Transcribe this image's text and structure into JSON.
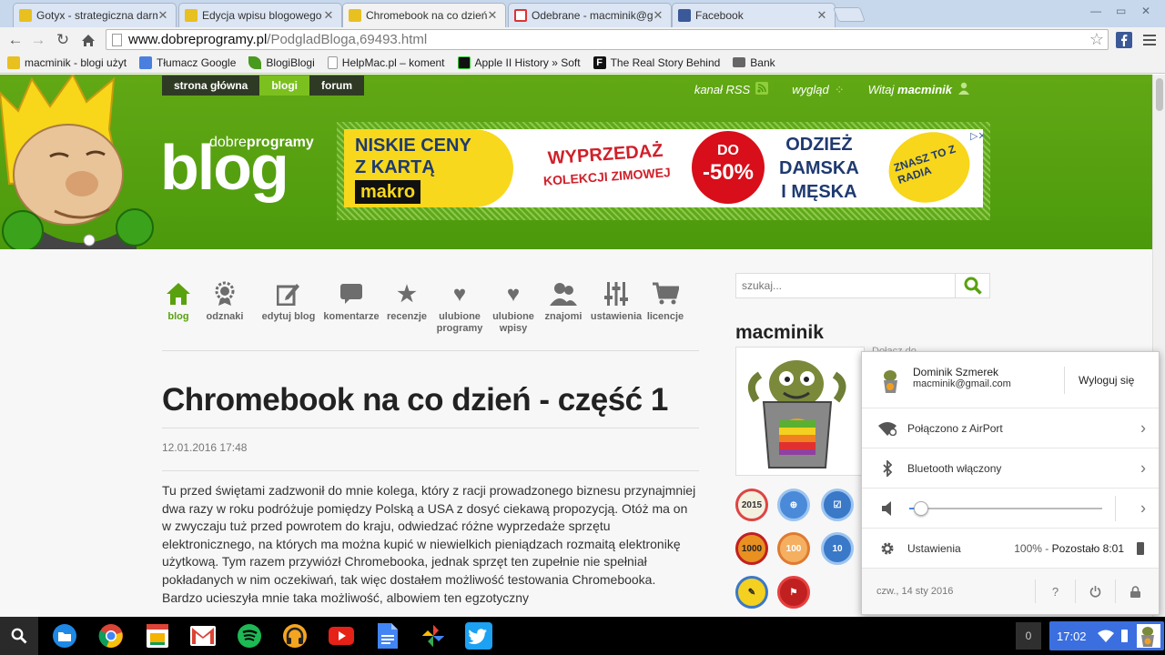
{
  "browser": {
    "tabs": [
      {
        "title": "Gotyx - strategiczna darm",
        "active": false
      },
      {
        "title": "Edycja wpisu blogowego",
        "active": false
      },
      {
        "title": "Chromebook na co dzień",
        "active": true
      },
      {
        "title": "Odebrane - macminik@gm",
        "active": false
      },
      {
        "title": "Facebook",
        "active": false
      }
    ],
    "url_host": "www.dobreprogramy.pl",
    "url_path": "/PodgladBloga,69493.html",
    "bookmarks": [
      {
        "label": "macminik - blogi użyt",
        "color": "#d33"
      },
      {
        "label": "Tłumacz Google",
        "color": "#4a7fe0"
      },
      {
        "label": "BlogiBlogi",
        "color": "#4a9a20"
      },
      {
        "label": "HelpMac.pl – koment",
        "color": "#999"
      },
      {
        "label": "Apple II History » Soft",
        "color": "#111"
      },
      {
        "label": "The Real Story Behind",
        "color": "#111"
      },
      {
        "label": "Bank",
        "color": "#666"
      }
    ]
  },
  "site": {
    "topnav": [
      "strona główna",
      "blogi",
      "forum"
    ],
    "rss": "kanał RSS",
    "look": "wygląd",
    "welcome": "Witaj",
    "welcome_user": "macminik",
    "logo_small_a": "dobre",
    "logo_small_b": "programy",
    "logo_big": "blog"
  },
  "ad": {
    "line1": "NISKIE CENY",
    "line2": "Z KARTĄ",
    "brand": "makro",
    "sale": "WYPRZEDAŻ",
    "sale_sub": "KOLEKCJI ZIMOWEJ",
    "discount_pre": "DO",
    "discount": "-50%",
    "clothes1": "ODZIEŻ",
    "clothes2": "DAMSKA",
    "clothes3": "I MĘSKA",
    "radio": "ZNASZ TO Z RADIA"
  },
  "blog_nav": [
    {
      "label": "blog",
      "icon": "home-icon",
      "selected": true
    },
    {
      "label": "odznaki",
      "icon": "medal-icon",
      "selected": false
    },
    {
      "label": "edytuj blog",
      "icon": "edit-icon",
      "selected": false
    },
    {
      "label": "komentarze",
      "icon": "comment-icon",
      "selected": false
    },
    {
      "label": "recenzje",
      "icon": "star-icon",
      "selected": false
    },
    {
      "label": "ulubione programy",
      "icon": "heart-icon",
      "selected": false
    },
    {
      "label": "ulubione wpisy",
      "icon": "heart-icon",
      "selected": false
    },
    {
      "label": "znajomi",
      "icon": "users-icon",
      "selected": false
    },
    {
      "label": "ustawienia",
      "icon": "sliders-icon",
      "selected": false
    },
    {
      "label": "licencje",
      "icon": "cart-icon",
      "selected": false
    }
  ],
  "post": {
    "title": "Chromebook na co dzień - część 1",
    "date": "12.01.2016 17:48",
    "body": "Tu przed świętami zadzwonił do mnie kolega, który z racji prowadzonego biznesu przynajmniej dwa razy w roku podróżuje pomiędzy Polską a USA z dosyć ciekawą propozycją. Otóż ma on w zwyczaju tuż przed powrotem do kraju, odwiedzać różne wyprzedaże sprzętu elektronicznego, na których ma można kupić w niewielkich pieniądzach rozmaitą elektronikę użytkową. Tym razem przywiózł Chromebooka, jednak sprzęt ten zupełnie nie spełniał pokładanych w nim oczekiwań, tak więc dostałem możliwość testowania Chromebooka. Bardzo ucieszyła mnie taka możliwość, albowiem ten egzotyczny"
  },
  "sidebar": {
    "search_placeholder": "szukaj...",
    "username": "macminik",
    "behind_text": "Dołącz do...",
    "badges": [
      "2015",
      "",
      "",
      "1000",
      "100",
      "10",
      "",
      ""
    ]
  },
  "tray": {
    "user_name": "Dominik Szmerek",
    "user_email": "macminik@gmail.com",
    "logout": "Wyloguj się",
    "wifi": "Połączono z AirPort",
    "bluetooth": "Bluetooth włączony",
    "volume": 0.06,
    "settings": "Ustawienia",
    "battery_percent": "100%",
    "battery_sep": " - ",
    "battery_remaining": "Pozostało 8:01",
    "date": "czw., 14 sty 2016",
    "help": "?"
  },
  "shelf": {
    "apps": [
      "files",
      "chrome",
      "slides",
      "gmail",
      "spotify",
      "headphones",
      "youtube",
      "docs",
      "photos",
      "twitter"
    ],
    "notifications": "0",
    "time": "17:02"
  }
}
